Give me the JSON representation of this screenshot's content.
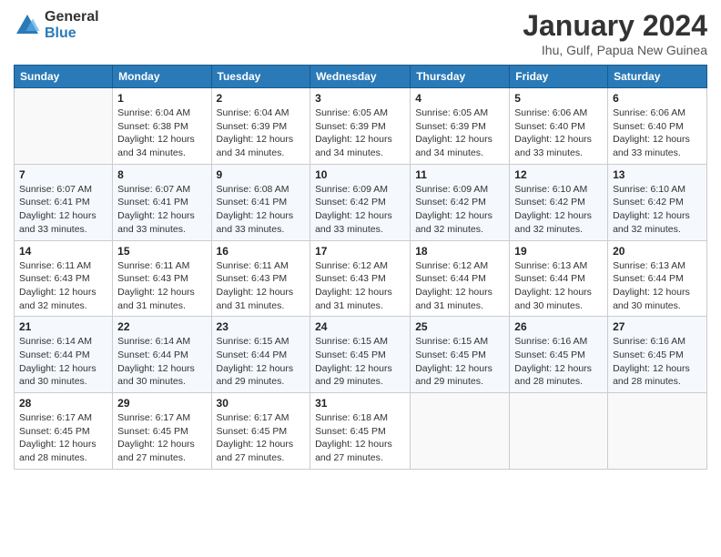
{
  "logo": {
    "general": "General",
    "blue": "Blue"
  },
  "title": "January 2024",
  "location": "Ihu, Gulf, Papua New Guinea",
  "days_header": [
    "Sunday",
    "Monday",
    "Tuesday",
    "Wednesday",
    "Thursday",
    "Friday",
    "Saturday"
  ],
  "weeks": [
    [
      {
        "num": "",
        "info": ""
      },
      {
        "num": "1",
        "info": "Sunrise: 6:04 AM\nSunset: 6:38 PM\nDaylight: 12 hours\nand 34 minutes."
      },
      {
        "num": "2",
        "info": "Sunrise: 6:04 AM\nSunset: 6:39 PM\nDaylight: 12 hours\nand 34 minutes."
      },
      {
        "num": "3",
        "info": "Sunrise: 6:05 AM\nSunset: 6:39 PM\nDaylight: 12 hours\nand 34 minutes."
      },
      {
        "num": "4",
        "info": "Sunrise: 6:05 AM\nSunset: 6:39 PM\nDaylight: 12 hours\nand 34 minutes."
      },
      {
        "num": "5",
        "info": "Sunrise: 6:06 AM\nSunset: 6:40 PM\nDaylight: 12 hours\nand 33 minutes."
      },
      {
        "num": "6",
        "info": "Sunrise: 6:06 AM\nSunset: 6:40 PM\nDaylight: 12 hours\nand 33 minutes."
      }
    ],
    [
      {
        "num": "7",
        "info": "Sunrise: 6:07 AM\nSunset: 6:41 PM\nDaylight: 12 hours\nand 33 minutes."
      },
      {
        "num": "8",
        "info": "Sunrise: 6:07 AM\nSunset: 6:41 PM\nDaylight: 12 hours\nand 33 minutes."
      },
      {
        "num": "9",
        "info": "Sunrise: 6:08 AM\nSunset: 6:41 PM\nDaylight: 12 hours\nand 33 minutes."
      },
      {
        "num": "10",
        "info": "Sunrise: 6:09 AM\nSunset: 6:42 PM\nDaylight: 12 hours\nand 33 minutes."
      },
      {
        "num": "11",
        "info": "Sunrise: 6:09 AM\nSunset: 6:42 PM\nDaylight: 12 hours\nand 32 minutes."
      },
      {
        "num": "12",
        "info": "Sunrise: 6:10 AM\nSunset: 6:42 PM\nDaylight: 12 hours\nand 32 minutes."
      },
      {
        "num": "13",
        "info": "Sunrise: 6:10 AM\nSunset: 6:42 PM\nDaylight: 12 hours\nand 32 minutes."
      }
    ],
    [
      {
        "num": "14",
        "info": "Sunrise: 6:11 AM\nSunset: 6:43 PM\nDaylight: 12 hours\nand 32 minutes."
      },
      {
        "num": "15",
        "info": "Sunrise: 6:11 AM\nSunset: 6:43 PM\nDaylight: 12 hours\nand 31 minutes."
      },
      {
        "num": "16",
        "info": "Sunrise: 6:11 AM\nSunset: 6:43 PM\nDaylight: 12 hours\nand 31 minutes."
      },
      {
        "num": "17",
        "info": "Sunrise: 6:12 AM\nSunset: 6:43 PM\nDaylight: 12 hours\nand 31 minutes."
      },
      {
        "num": "18",
        "info": "Sunrise: 6:12 AM\nSunset: 6:44 PM\nDaylight: 12 hours\nand 31 minutes."
      },
      {
        "num": "19",
        "info": "Sunrise: 6:13 AM\nSunset: 6:44 PM\nDaylight: 12 hours\nand 30 minutes."
      },
      {
        "num": "20",
        "info": "Sunrise: 6:13 AM\nSunset: 6:44 PM\nDaylight: 12 hours\nand 30 minutes."
      }
    ],
    [
      {
        "num": "21",
        "info": "Sunrise: 6:14 AM\nSunset: 6:44 PM\nDaylight: 12 hours\nand 30 minutes."
      },
      {
        "num": "22",
        "info": "Sunrise: 6:14 AM\nSunset: 6:44 PM\nDaylight: 12 hours\nand 30 minutes."
      },
      {
        "num": "23",
        "info": "Sunrise: 6:15 AM\nSunset: 6:44 PM\nDaylight: 12 hours\nand 29 minutes."
      },
      {
        "num": "24",
        "info": "Sunrise: 6:15 AM\nSunset: 6:45 PM\nDaylight: 12 hours\nand 29 minutes."
      },
      {
        "num": "25",
        "info": "Sunrise: 6:15 AM\nSunset: 6:45 PM\nDaylight: 12 hours\nand 29 minutes."
      },
      {
        "num": "26",
        "info": "Sunrise: 6:16 AM\nSunset: 6:45 PM\nDaylight: 12 hours\nand 28 minutes."
      },
      {
        "num": "27",
        "info": "Sunrise: 6:16 AM\nSunset: 6:45 PM\nDaylight: 12 hours\nand 28 minutes."
      }
    ],
    [
      {
        "num": "28",
        "info": "Sunrise: 6:17 AM\nSunset: 6:45 PM\nDaylight: 12 hours\nand 28 minutes."
      },
      {
        "num": "29",
        "info": "Sunrise: 6:17 AM\nSunset: 6:45 PM\nDaylight: 12 hours\nand 27 minutes."
      },
      {
        "num": "30",
        "info": "Sunrise: 6:17 AM\nSunset: 6:45 PM\nDaylight: 12 hours\nand 27 minutes."
      },
      {
        "num": "31",
        "info": "Sunrise: 6:18 AM\nSunset: 6:45 PM\nDaylight: 12 hours\nand 27 minutes."
      },
      {
        "num": "",
        "info": ""
      },
      {
        "num": "",
        "info": ""
      },
      {
        "num": "",
        "info": ""
      }
    ]
  ]
}
